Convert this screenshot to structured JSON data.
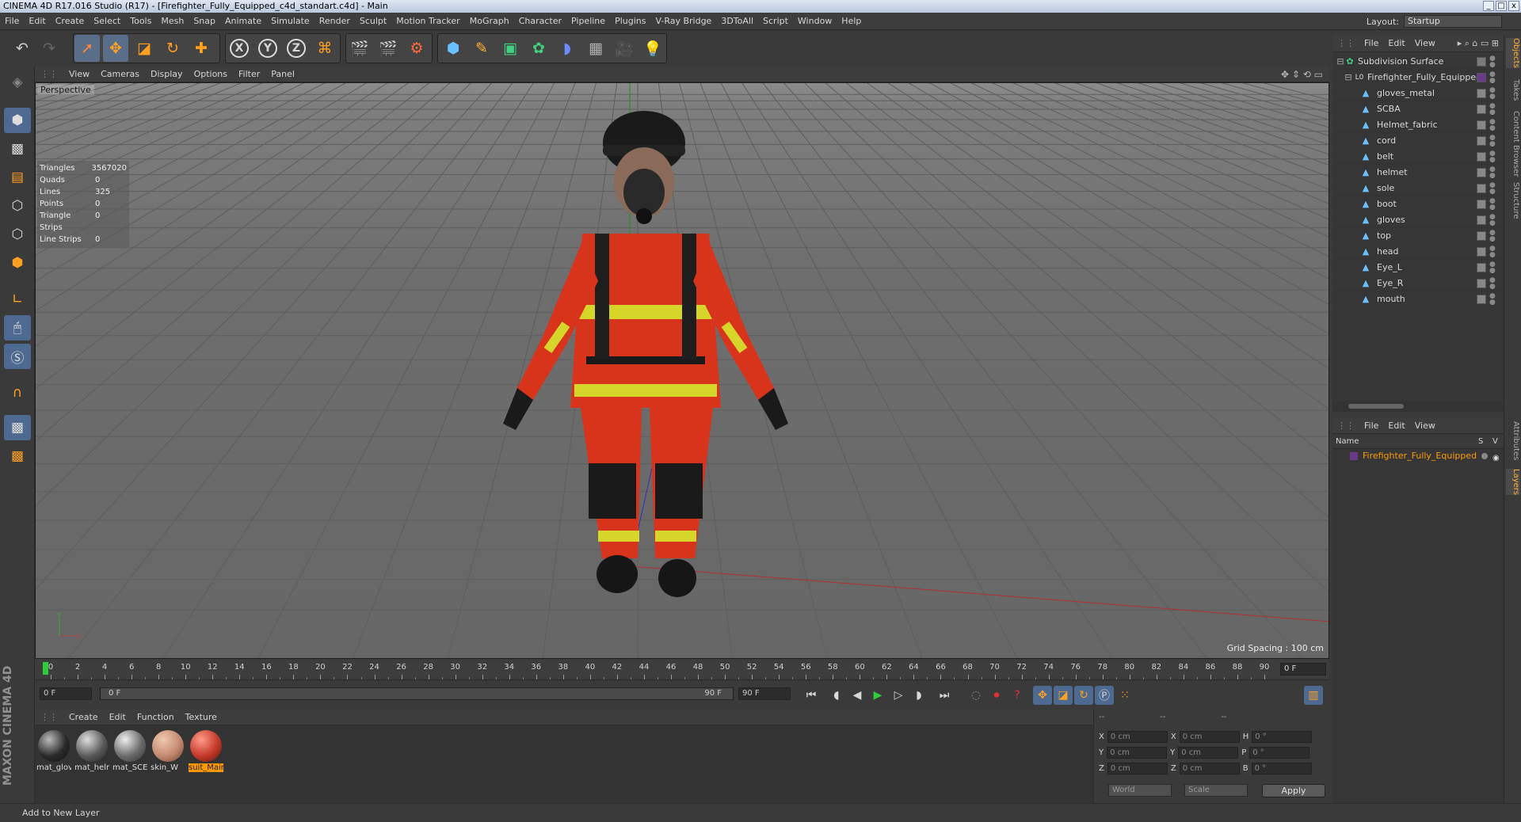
{
  "window": {
    "title": "CINEMA 4D R17.016 Studio (R17) - [Firefighter_Fully_Equipped_c4d_standart.c4d] - Main"
  },
  "menubar": {
    "items": [
      "File",
      "Edit",
      "Create",
      "Select",
      "Tools",
      "Mesh",
      "Snap",
      "Animate",
      "Simulate",
      "Render",
      "Sculpt",
      "Motion Tracker",
      "MoGraph",
      "Character",
      "Pipeline",
      "Plugins",
      "V-Ray Bridge",
      "3DToAll",
      "Script",
      "Window",
      "Help"
    ],
    "layout_label": "Layout:",
    "layout_value": "Startup"
  },
  "viewport": {
    "menu": [
      "View",
      "Cameras",
      "Display",
      "Options",
      "Filter",
      "Panel"
    ],
    "camera_label": "Perspective",
    "stats": [
      {
        "k": "Triangles",
        "v": "3567020"
      },
      {
        "k": "Quads",
        "v": "0"
      },
      {
        "k": "Lines",
        "v": "325"
      },
      {
        "k": "Points",
        "v": "0"
      },
      {
        "k": "Triangle Strips",
        "v": "0"
      },
      {
        "k": "Line Strips",
        "v": "0"
      }
    ],
    "grid_spacing": "Grid Spacing : 100 cm"
  },
  "timeline": {
    "ticks": [
      "0",
      "2",
      "4",
      "6",
      "8",
      "10",
      "12",
      "14",
      "16",
      "18",
      "20",
      "22",
      "24",
      "26",
      "28",
      "30",
      "32",
      "34",
      "36",
      "38",
      "40",
      "42",
      "44",
      "46",
      "48",
      "50",
      "52",
      "54",
      "56",
      "58",
      "60",
      "62",
      "64",
      "66",
      "68",
      "70",
      "72",
      "74",
      "76",
      "78",
      "80",
      "82",
      "84",
      "86",
      "88",
      "90"
    ],
    "frame_end_display": "0 F",
    "start_field": "0 F",
    "range_start": "0 F",
    "range_end": "90 F",
    "end_field": "90 F"
  },
  "materials": {
    "menu": [
      "Create",
      "Edit",
      "Function",
      "Texture"
    ],
    "items": [
      {
        "label": "mat_glov",
        "color": "#2a2a2a"
      },
      {
        "label": "mat_helr",
        "color": "#5a5a5a"
      },
      {
        "label": "mat_SCE",
        "color": "#6a6a6a"
      },
      {
        "label": "skin_W",
        "color": "#c48a70"
      },
      {
        "label": "suit_Mair",
        "color": "#c43a2a"
      }
    ],
    "selected_index": 4
  },
  "coords": {
    "header": [
      "--",
      "--",
      "--"
    ],
    "rows": [
      {
        "a": "X",
        "v1": "0 cm",
        "b": "X",
        "v2": "0 cm",
        "c": "H",
        "v3": "0 °"
      },
      {
        "a": "Y",
        "v1": "0 cm",
        "b": "Y",
        "v2": "0 cm",
        "c": "P",
        "v3": "0 °"
      },
      {
        "a": "Z",
        "v1": "0 cm",
        "b": "Z",
        "v2": "0 cm",
        "c": "B",
        "v3": "0 °"
      }
    ],
    "space": "World",
    "mode": "Scale",
    "apply": "Apply"
  },
  "status": {
    "text": "Add to New Layer"
  },
  "objects": {
    "menu": [
      "File",
      "Edit",
      "View"
    ],
    "root": "Subdivision Surface",
    "group": "Firefighter_Fully_Equipped",
    "children": [
      "gloves_metal",
      "SCBA",
      "Helmet_fabric",
      "cord",
      "belt",
      "helmet",
      "sole",
      "boot",
      "gloves",
      "top",
      "head",
      "Eye_L",
      "Eye_R",
      "mouth"
    ]
  },
  "layers": {
    "menu": [
      "File",
      "Edit",
      "View"
    ],
    "col_name": "Name",
    "col_s": "S",
    "col_v": "V",
    "row": "Firefighter_Fully_Equipped"
  },
  "sidetabs": [
    "Objects",
    "Takes",
    "Content Browser",
    "Structure",
    "Attributes",
    "Layers"
  ]
}
